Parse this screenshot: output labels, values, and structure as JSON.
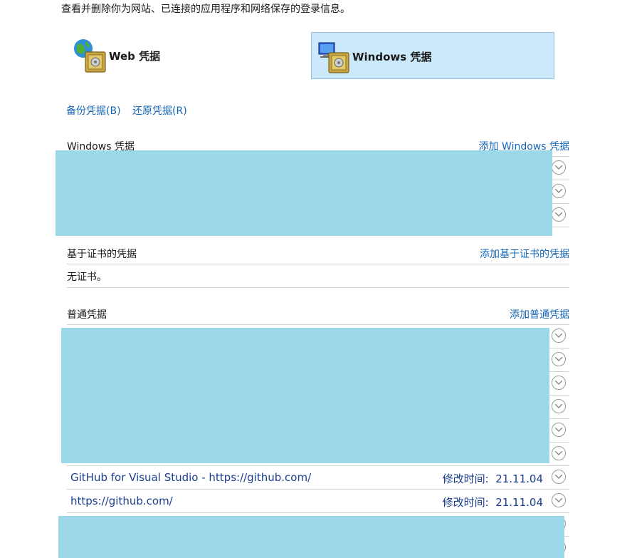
{
  "description": "查看并删除你为网站、已连接的应用程序和网络保存的登录信息。",
  "tiles": {
    "web_label": "Web 凭据",
    "windows_label": "Windows 凭据"
  },
  "actions": {
    "backup": "备份凭据(B)",
    "restore": "还原凭据(R)"
  },
  "windows_section": {
    "title": "Windows 凭据",
    "add": "添加 Windows 凭据"
  },
  "cert_section": {
    "title": "基于证书的凭据",
    "add": "添加基于证书的凭据",
    "empty": "无证书。"
  },
  "generic_section": {
    "title": "普通凭据",
    "add": "添加普通凭据",
    "items": [
      {
        "name": "GitHub for Visual Studio - https://github.com/",
        "modified_label": "修改时间:",
        "modified_date": "21.11.04"
      },
      {
        "name": "https://github.com/",
        "modified_label": "修改时间:",
        "modified_date": "21.11.04"
      }
    ]
  },
  "colors": {
    "link": "#1667b8",
    "selected_tile": "#cce8fb",
    "redaction": "#9bd9ea"
  }
}
